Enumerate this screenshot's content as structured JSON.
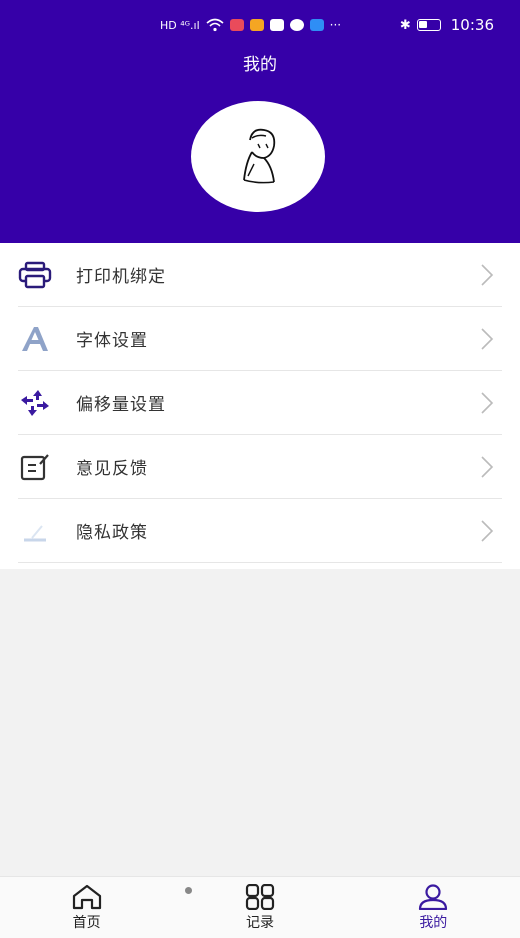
{
  "status_bar": {
    "left_indicators": "HD ⁴ᴳ.ıl",
    "more": "···",
    "bluetooth": "✱",
    "time": "10:36"
  },
  "header": {
    "title": "我的",
    "background_color": "#3600a8"
  },
  "menu": {
    "items": [
      {
        "label": "打印机绑定",
        "icon": "printer-icon"
      },
      {
        "label": "字体设置",
        "icon": "font-icon"
      },
      {
        "label": "偏移量设置",
        "icon": "offset-arrows-icon"
      },
      {
        "label": "意见反馈",
        "icon": "feedback-edit-icon"
      },
      {
        "label": "隐私政策",
        "icon": "privacy-icon"
      }
    ]
  },
  "tabbar": {
    "tabs": [
      {
        "label": "首页",
        "icon": "home-icon"
      },
      {
        "label": "记录",
        "icon": "grid-icon"
      },
      {
        "label": "我的",
        "icon": "user-icon",
        "active": true
      }
    ],
    "active_color": "#3a1aa0"
  }
}
